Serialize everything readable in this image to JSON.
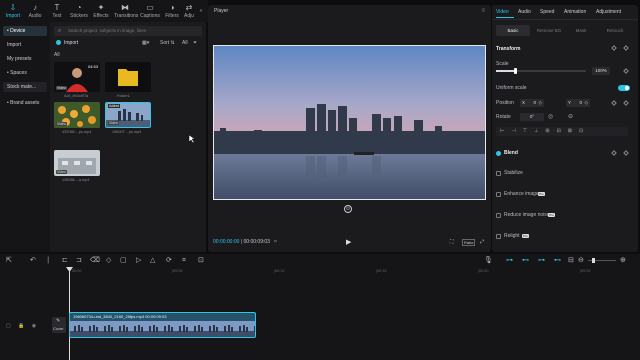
{
  "toolbar": {
    "items": [
      {
        "label": "Import",
        "icon": "import-icon",
        "active": true
      },
      {
        "label": "Audio",
        "icon": "music-note-icon"
      },
      {
        "label": "Text",
        "icon": "text-icon"
      },
      {
        "label": "Stickers",
        "icon": "sticker-icon"
      },
      {
        "label": "Effects",
        "icon": "sparkle-icon"
      },
      {
        "label": "Transitions",
        "icon": "transition-icon"
      },
      {
        "label": "Captions",
        "icon": "captions-icon"
      },
      {
        "label": "Filters",
        "icon": "filter-icon"
      },
      {
        "label": "Adju",
        "icon": "adjust-icon"
      }
    ],
    "more": "»"
  },
  "sidebar": {
    "items": [
      "• Device",
      "Import",
      "My presets",
      "• Spaces",
      "Stock mate...",
      "• Brand assets"
    ]
  },
  "media": {
    "search_placeholder": "Search project, subjects in image, lines",
    "import_label": "Import",
    "sort_label": "Sort",
    "all_label": "All",
    "filter_all": "All",
    "items": [
      {
        "caption": "AJ6_lb0Iu9ITa",
        "duration": "04:53",
        "tag": "Video"
      },
      {
        "caption": "Folder1",
        "duration": "",
        "tag": ""
      },
      {
        "caption": "432085....ps.mp4",
        "duration": "",
        "tag": "Video"
      },
      {
        "caption": "196007....ps.mp4",
        "duration": "",
        "tag": "Video",
        "badge": "Added"
      },
      {
        "caption": "128088....a.mp4",
        "duration": "",
        "tag": "Video"
      }
    ]
  },
  "player": {
    "title": "Player",
    "time_current": "00:00:00:00",
    "time_total": "00:00:09:03",
    "ratio": "Ratio"
  },
  "props": {
    "tabs": [
      "Video",
      "Audio",
      "Speed",
      "Animation",
      "Adjustment"
    ],
    "subtabs": [
      "Basic",
      "Remove BG",
      "Mask",
      "Retouch"
    ],
    "transform": "Transform",
    "scale": "Scale",
    "scale_value": "100%",
    "uniform_scale": "Uniform scale",
    "position": "Position",
    "pos_x_label": "X",
    "pos_x": "0",
    "pos_y_label": "Y",
    "pos_y": "0",
    "rotate": "Rotate",
    "rotate_value": "0°",
    "blend": "Blend",
    "stabilize": "Stabilize",
    "enhance": "Enhance image",
    "noise": "Reduce image noise",
    "relight": "Relight",
    "pro": "Pro"
  },
  "timeline": {
    "ruler": [
      "00:00",
      "|00:05",
      "|00:10",
      "|00:15",
      "|00:20",
      "|00:25"
    ],
    "clip_label": "196060734-uhd_3840_2160_25fps.mp4  00:00:09:03",
    "cover_label": "Cover",
    "accent": "#2ec6e6"
  }
}
